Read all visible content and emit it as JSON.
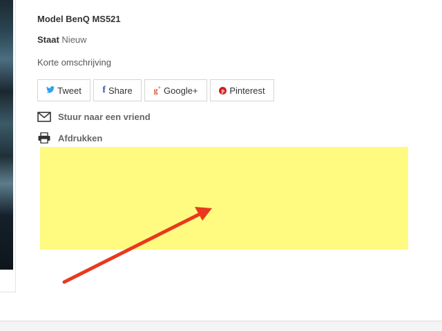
{
  "product": {
    "model": "Model BenQ MS521",
    "state_label": "Staat",
    "state_value": "Nieuw",
    "short_description": "Korte omschrijving"
  },
  "share": {
    "tweet": "Tweet",
    "facebook": "Share",
    "gplus": "Google+",
    "pinterest": "Pinterest",
    "icons": {
      "twitter": "twitter-icon",
      "facebook": "facebook-icon",
      "gplus": "google-plus-icon",
      "pinterest": "pinterest-icon"
    }
  },
  "actions": {
    "send_friend": "Stuur naar een vriend",
    "print": "Afdrukken"
  },
  "colors": {
    "highlight": "#fffa80",
    "arrow": "#e8391d",
    "twitter": "#2ea3e6",
    "facebook": "#3b5998",
    "gplus": "#d95232",
    "pinterest": "#ce1f21"
  }
}
